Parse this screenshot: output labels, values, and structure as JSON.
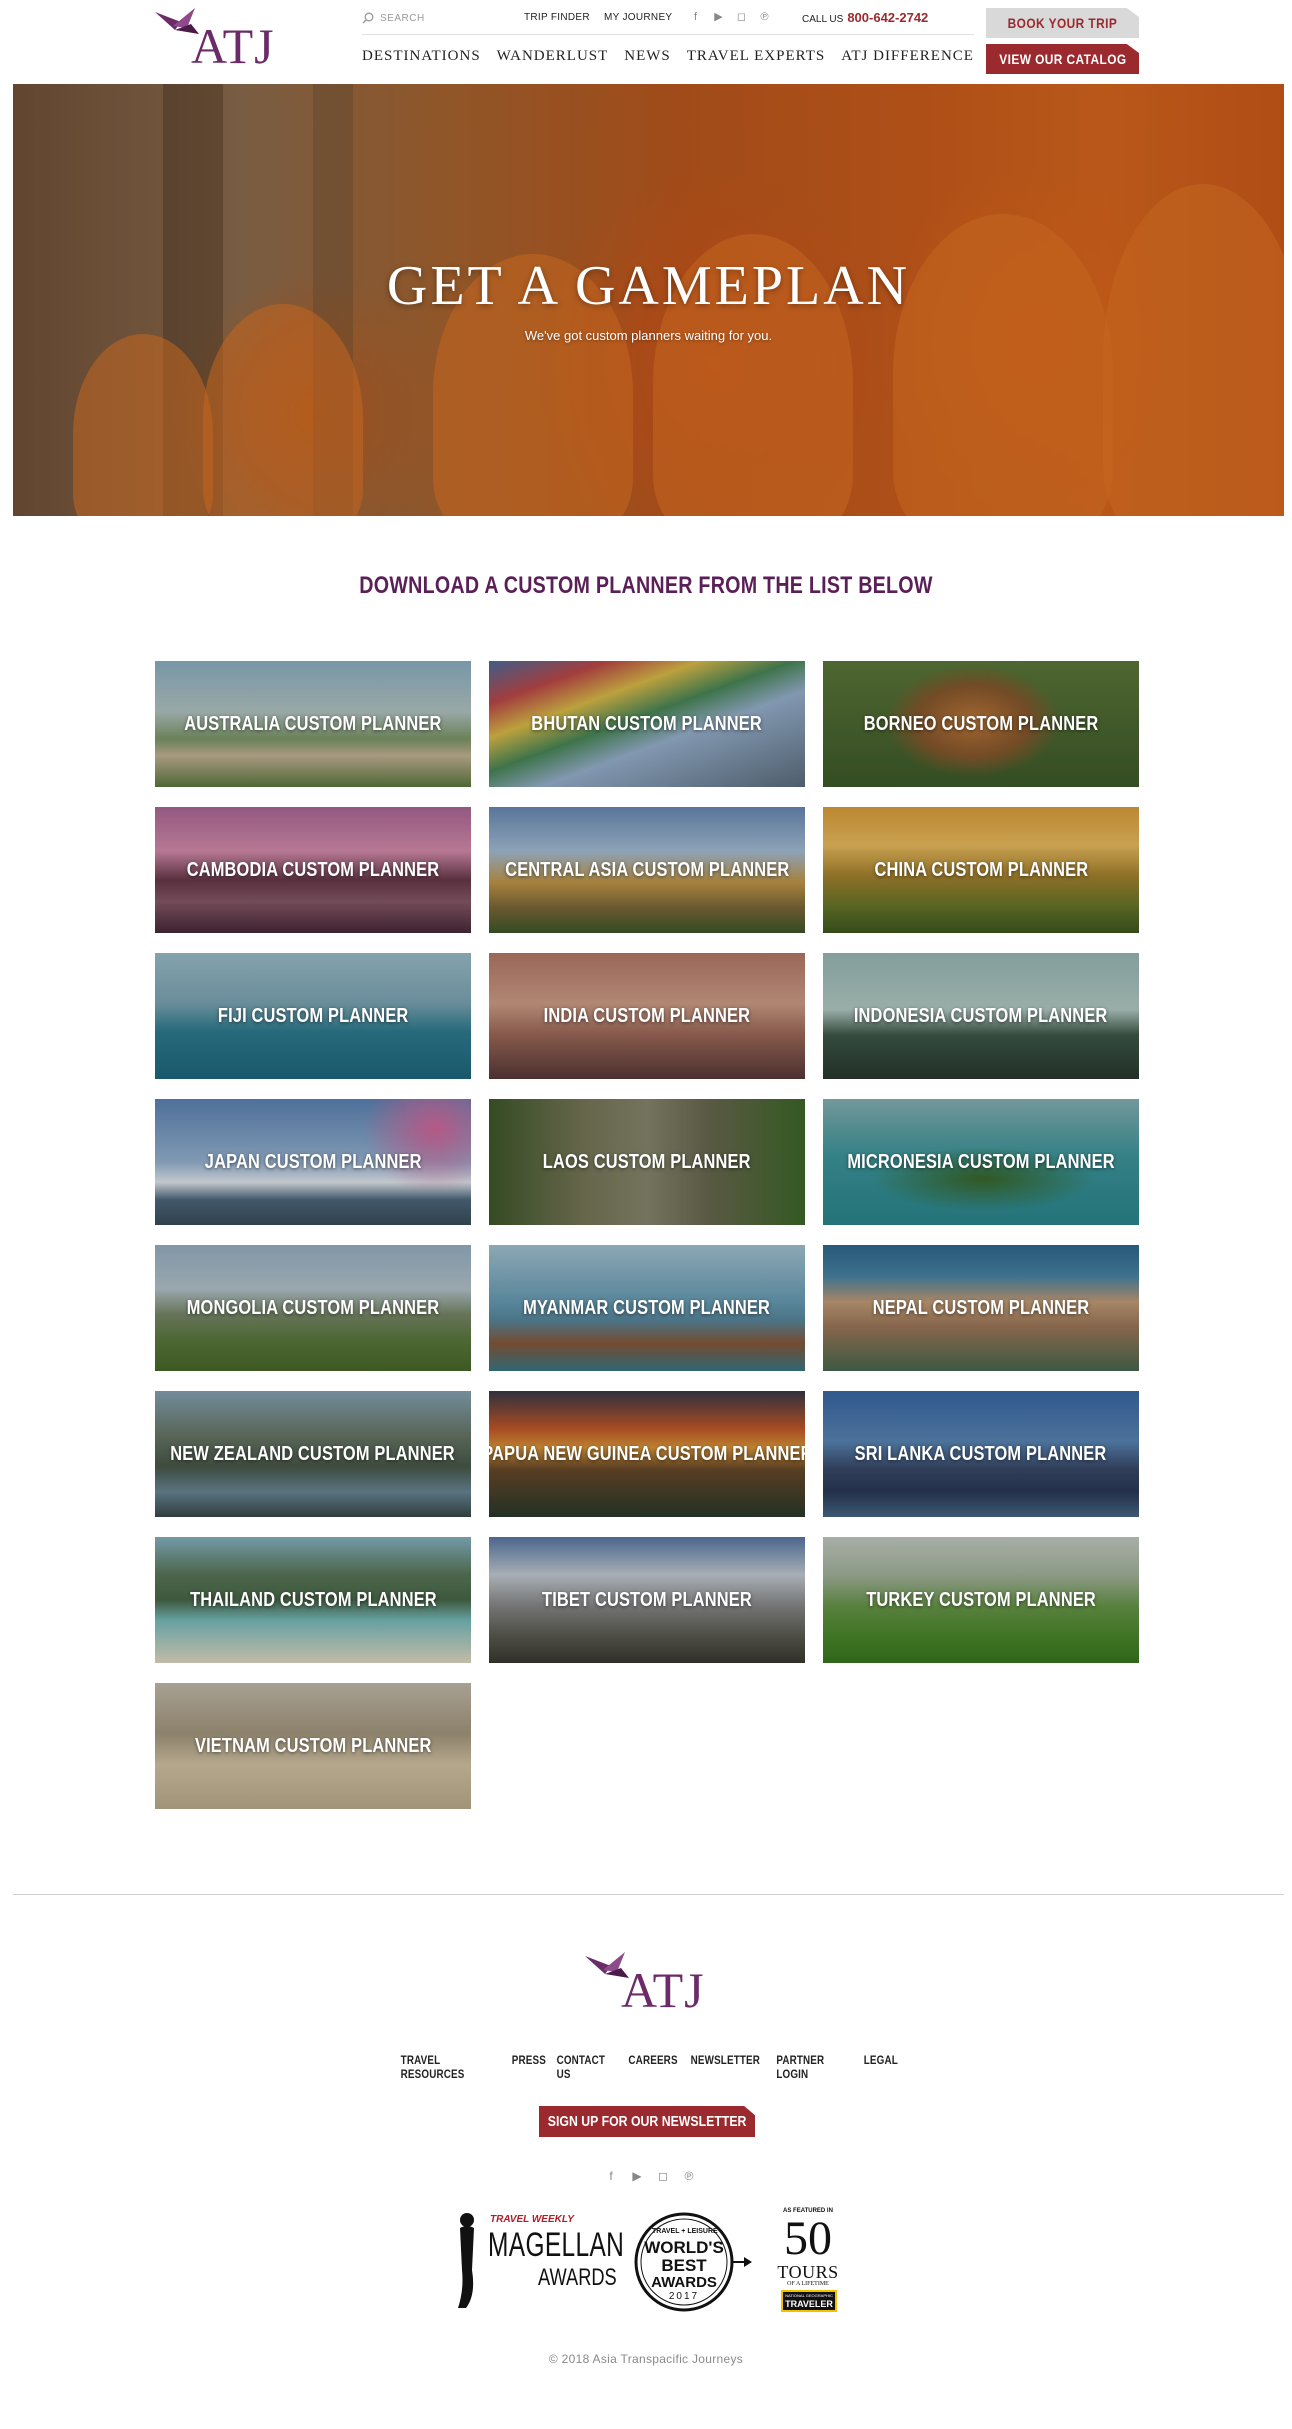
{
  "header": {
    "logo_text": "ATJ",
    "search_placeholder": "SEARCH",
    "trip_finder": "TRIP FINDER",
    "my_journey": "MY JOURNEY",
    "call_label": "CALL US",
    "phone": "800-642-2742",
    "book_trip": "BOOK YOUR TRIP",
    "view_catalog": "VIEW OUR CATALOG",
    "social_icons": [
      "facebook-icon",
      "youtube-icon",
      "instagram-icon",
      "pinterest-icon"
    ],
    "nav": [
      "DESTINATIONS",
      "WANDERLUST",
      "NEWS",
      "TRAVEL EXPERTS",
      "ATJ DIFFERENCE"
    ]
  },
  "hero": {
    "title": "GET A GAMEPLAN",
    "subtitle": "We've got custom planners waiting for you."
  },
  "planners": {
    "title": "DOWNLOAD A CUSTOM PLANNER FROM THE LIST BELOW",
    "items": [
      {
        "label": "AUSTRALIA CUSTOM PLANNER"
      },
      {
        "label": "BHUTAN CUSTOM PLANNER"
      },
      {
        "label": "BORNEO CUSTOM PLANNER"
      },
      {
        "label": "CAMBODIA CUSTOM PLANNER"
      },
      {
        "label": "CENTRAL ASIA CUSTOM PLANNER"
      },
      {
        "label": "CHINA CUSTOM PLANNER"
      },
      {
        "label": "FIJI CUSTOM PLANNER"
      },
      {
        "label": "INDIA CUSTOM PLANNER"
      },
      {
        "label": "INDONESIA CUSTOM PLANNER"
      },
      {
        "label": "JAPAN CUSTOM PLANNER"
      },
      {
        "label": "LAOS CUSTOM PLANNER"
      },
      {
        "label": "MICRONESIA CUSTOM PLANNER"
      },
      {
        "label": "MONGOLIA CUSTOM PLANNER"
      },
      {
        "label": "MYANMAR CUSTOM PLANNER"
      },
      {
        "label": "NEPAL CUSTOM PLANNER"
      },
      {
        "label": "NEW ZEALAND CUSTOM PLANNER"
      },
      {
        "label": "PAPUA NEW GUINEA CUSTOM PLANNER"
      },
      {
        "label": "SRI LANKA CUSTOM PLANNER"
      },
      {
        "label": "THAILAND CUSTOM PLANNER"
      },
      {
        "label": "TIBET CUSTOM PLANNER"
      },
      {
        "label": "TURKEY CUSTOM PLANNER"
      },
      {
        "label": "VIETNAM CUSTOM PLANNER"
      }
    ]
  },
  "footer": {
    "logo_text": "ATJ",
    "links": [
      "TRAVEL RESOURCES",
      "PRESS",
      "CONTACT US",
      "CAREERS",
      "NEWSLETTER",
      "PARTNER LOGIN",
      "LEGAL"
    ],
    "newsletter_button": "SIGN UP FOR OUR NEWSLETTER",
    "social_icons": [
      "facebook-icon",
      "youtube-icon",
      "instagram-icon",
      "pinterest-icon"
    ],
    "awards": {
      "magellan": {
        "kicker": "TRAVEL WEEKLY",
        "line1": "MAGELLAN",
        "line2": "AWARDS"
      },
      "worlds_best": {
        "kicker": "TRAVEL + LEISURE",
        "line1": "WORLD'S",
        "line2": "BEST",
        "line3": "AWARDS",
        "year": "2017"
      },
      "tours": {
        "kicker": "AS FEATURED IN",
        "number": "50",
        "line1": "TOURS",
        "line2": "OF A LIFETIME",
        "badge1": "NATIONAL GEOGRAPHIC",
        "badge2": "TRAVELER"
      }
    },
    "copyright": "© 2018 Asia Transpacific Journeys"
  },
  "theme": {
    "brand_purple": "#6b2b69",
    "accent_red": "#9b2a2f"
  }
}
